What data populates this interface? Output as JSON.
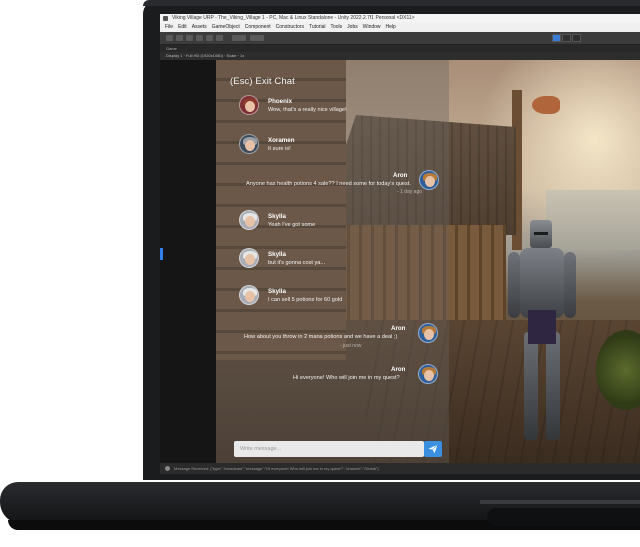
{
  "editor": {
    "title": "Viking Village URP - The_Viking_Village 1 - PC, Mac & Linux Standalone - Unity 2022.2.7f1 Personal <DX11>",
    "menu": [
      "File",
      "Edit",
      "Assets",
      "GameObject",
      "Component",
      "Constructors",
      "Tutorial",
      "Tools",
      "Jobs",
      "Window",
      "Help"
    ],
    "tab_label": "Game",
    "game_bar": "Display 1   ·   Full HD (1920x1080)   ·   Scale  ·   1x",
    "status_text": "Message Received: {\"type\":\"broadcast\",\"message\":\"Hi everyone! Who will join me in my quest?\",\"channel\":\"Global\"}"
  },
  "chat": {
    "exit_label": "(Esc) Exit Chat",
    "input_placeholder": "Write message...",
    "messages": [
      {
        "author": "Phoenix",
        "text": "Wow, that's a really nice village!",
        "side": "left",
        "avatar": "phoenix"
      },
      {
        "author": "Xoramen",
        "text": "It sure is!",
        "side": "left",
        "avatar": "xoramen"
      },
      {
        "author": "Aron",
        "text": "Anyone has health potions 4 sale?? I need some for today's quest.",
        "faint": "- 1 day ago",
        "side": "right",
        "avatar": "aron"
      },
      {
        "author": "Skylla",
        "text": "Yeah I've got some",
        "side": "left",
        "avatar": "skylla"
      },
      {
        "author": "Skylla",
        "text": "but it's gonna cost ya...",
        "side": "left",
        "avatar": "skylla"
      },
      {
        "author": "Skylla",
        "text": "I can sell 5 potions for 60 gold",
        "side": "left",
        "avatar": "skylla"
      },
      {
        "author": "Aron",
        "text": "How about you throw in 2 mana potions and we have a deal ;)",
        "faint": "- just now",
        "side": "right",
        "avatar": "aron"
      },
      {
        "author": "Aron",
        "text": "Hi everyone! Who will join me in my quest?",
        "side": "right",
        "avatar": "aron"
      }
    ]
  },
  "icons": {
    "send": "send-icon",
    "windows": "unity-icon"
  },
  "colors": {
    "accent": "#3b8fe0",
    "editor_bg": "#1e1e1e",
    "laptop": "#1b1c1e"
  }
}
